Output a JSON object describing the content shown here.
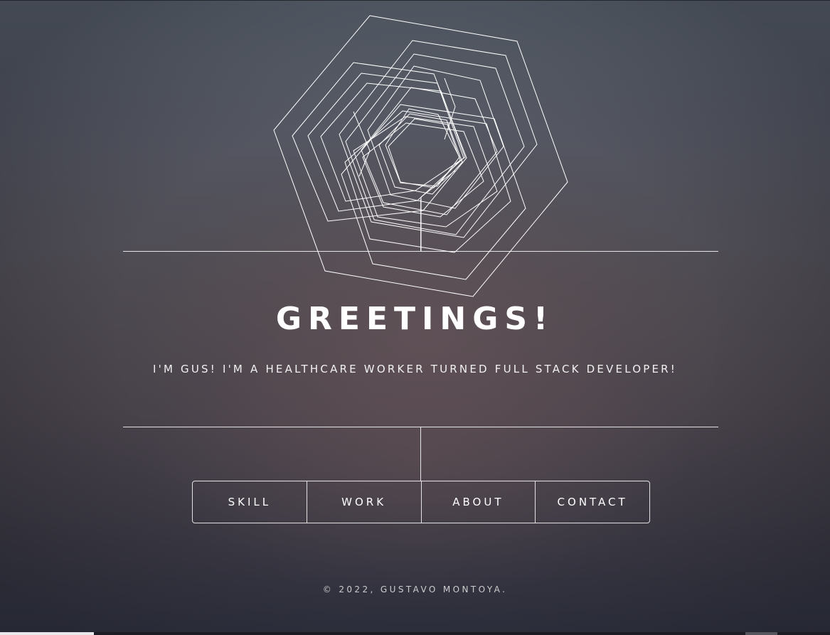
{
  "hero": {
    "title": "GREETINGS!",
    "subtitle": "I'M GUS! I'M A HEALTHCARE WORKER TURNED FULL STACK DEVELOPER!",
    "logo_icon": "hexagon-logo-icon"
  },
  "nav": {
    "items": [
      {
        "label": "SKILL"
      },
      {
        "label": "WORK"
      },
      {
        "label": "ABOUT"
      },
      {
        "label": "CONTACT"
      }
    ]
  },
  "footer": {
    "text": "© 2022, GUSTAVO MONTOYA."
  },
  "colors": {
    "text": "#ffffff",
    "line": "#ffffff",
    "background_top": "#5d6570",
    "background_bottom": "#303240"
  }
}
